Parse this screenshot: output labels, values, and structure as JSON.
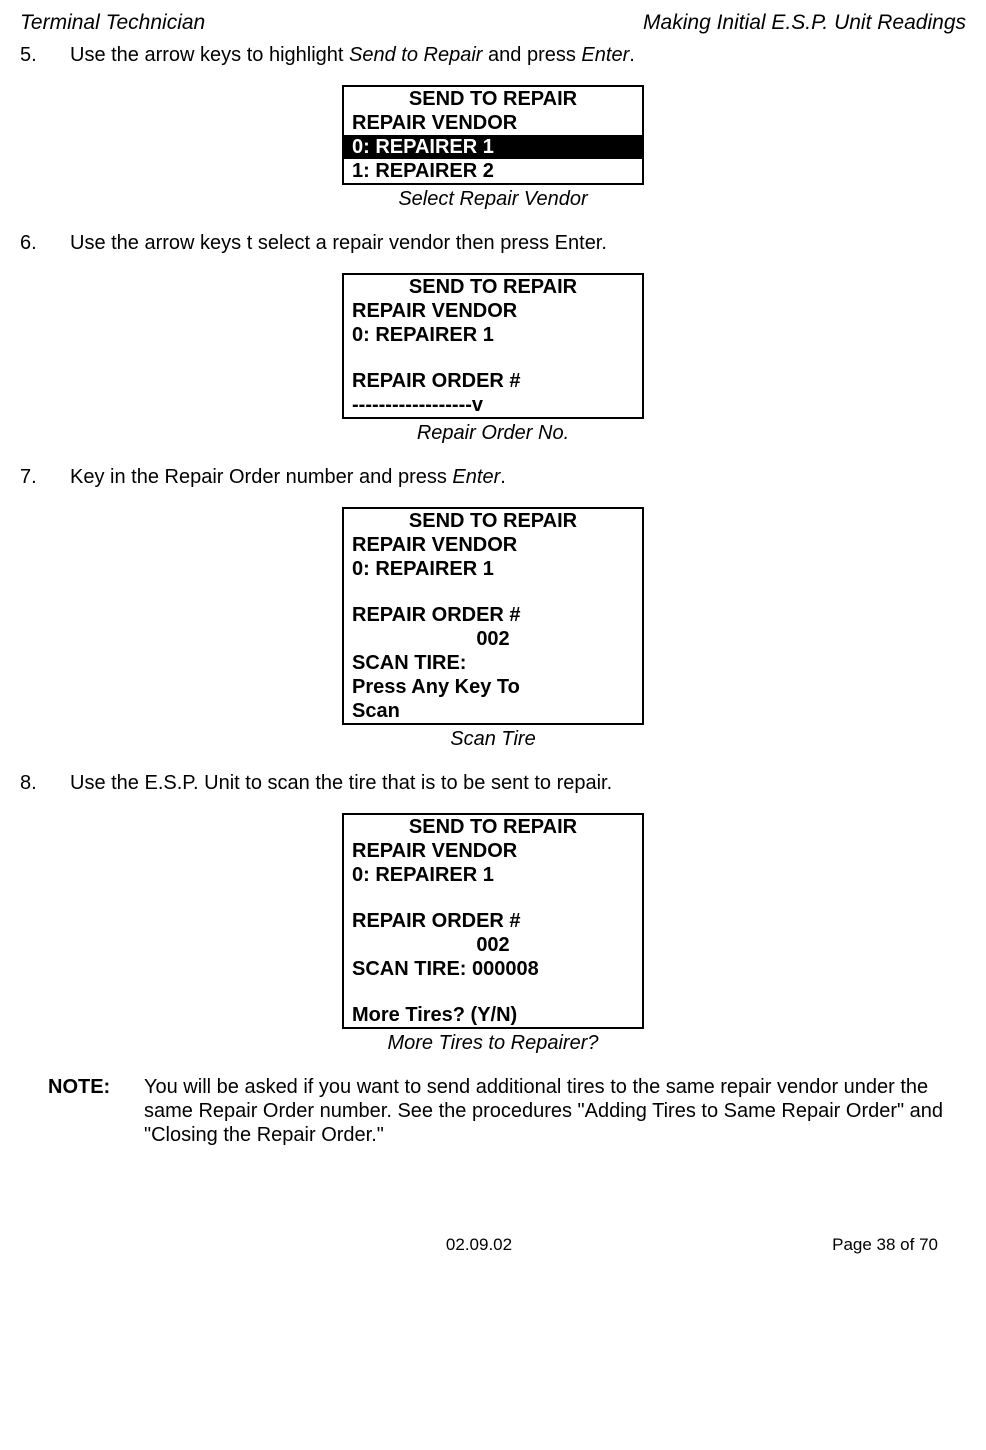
{
  "header": {
    "left": "Terminal Technician",
    "right": "Making Initial E.S.P. Unit Readings"
  },
  "steps": {
    "s5": {
      "num": "5.",
      "text_a": "Use the arrow keys to highlight ",
      "em1": "Send to ",
      "em2": "Repair",
      "text_b": " and press ",
      "em3": "Enter",
      "text_c": "."
    },
    "s6": {
      "num": "6.",
      "text": "Use the arrow keys t select a repair vendor then press Enter."
    },
    "s7": {
      "num": "7.",
      "text_a": "Key in the Repair Order number and press ",
      "em": "Enter",
      "text_b": "."
    },
    "s8": {
      "num": "8.",
      "text": "Use the E.S.P. Unit to scan the tire that is to be sent to repair."
    }
  },
  "screens": {
    "a": {
      "title": "SEND TO REPAIR",
      "l1": "REPAIR VENDOR",
      "sel": "0: REPAIRER 1",
      "l2": "1: REPAIRER 2",
      "caption": "Select Repair Vendor"
    },
    "b": {
      "title": "SEND TO REPAIR",
      "l1": "REPAIR VENDOR",
      "l2": "0: REPAIRER 1",
      "l3": "REPAIR ORDER #",
      "l4": "------------------v",
      "caption": "Repair Order No."
    },
    "c": {
      "title": "SEND TO REPAIR",
      "l1": "REPAIR VENDOR",
      "l2": "0: REPAIRER 1",
      "l3": "REPAIR ORDER #",
      "l4": "002",
      "l5": "SCAN TIRE:",
      "l6": "Press Any Key To",
      "l7": "Scan",
      "caption": "Scan Tire"
    },
    "d": {
      "title": "SEND TO REPAIR",
      "l1": "REPAIR VENDOR",
      "l2": "0: REPAIRER 1",
      "l3": "REPAIR ORDER #",
      "l4": "002",
      "l5": "SCAN TIRE: 000008",
      "l6": "More Tires? (Y/N)",
      "caption": "More Tires to Repairer?"
    }
  },
  "note": {
    "label": "NOTE:",
    "text": "You will be asked if you want to send additional tires to the same repair vendor under the same Repair Order number.  See the procedures \"Adding Tires to Same Repair Order\" and \"Closing the Repair Order.\""
  },
  "footer": {
    "date": "02.09.02",
    "page": "Page 38 of 70"
  }
}
